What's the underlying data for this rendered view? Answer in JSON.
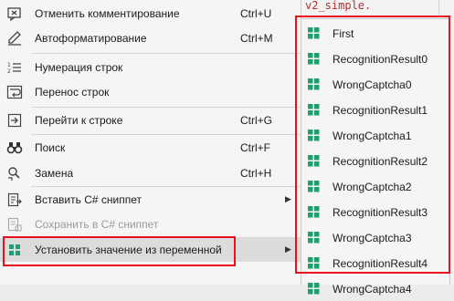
{
  "background": {
    "editor_code": "v2_simple."
  },
  "menu": {
    "items": [
      {
        "label": "Отменить комментирование",
        "shortcut": "Ctrl+U",
        "icon": "uncomment-icon"
      },
      {
        "label": "Автоформатирование",
        "shortcut": "Ctrl+M",
        "icon": "pencil-icon"
      },
      {
        "label": "Нумерация строк",
        "shortcut": "",
        "icon": "line-numbers-icon"
      },
      {
        "label": "Перенос строк",
        "shortcut": "",
        "icon": "word-wrap-icon"
      },
      {
        "label": "Перейти к строке",
        "shortcut": "Ctrl+G",
        "icon": "goto-line-icon"
      },
      {
        "label": "Поиск",
        "shortcut": "Ctrl+F",
        "icon": "binoculars-icon"
      },
      {
        "label": "Замена",
        "shortcut": "Ctrl+H",
        "icon": "replace-icon"
      },
      {
        "label": "Вставить C# сниппет",
        "shortcut": "",
        "icon": "insert-snippet-icon"
      },
      {
        "label": "Сохранить в C# сниппет",
        "shortcut": "",
        "icon": "save-snippet-icon"
      },
      {
        "label": "Установить значение из переменной",
        "shortcut": "",
        "icon": "variable-grid-icon"
      }
    ]
  },
  "submenu": {
    "items": [
      {
        "label": "First"
      },
      {
        "label": "RecognitionResult0"
      },
      {
        "label": "WrongCaptcha0"
      },
      {
        "label": "RecognitionResult1"
      },
      {
        "label": "WrongCaptcha1"
      },
      {
        "label": "RecognitionResult2"
      },
      {
        "label": "WrongCaptcha2"
      },
      {
        "label": "RecognitionResult3"
      },
      {
        "label": "WrongCaptcha3"
      },
      {
        "label": "RecognitionResult4"
      },
      {
        "label": "WrongCaptcha4"
      }
    ]
  },
  "colors": {
    "highlight_border": "#e8101c",
    "grid_icon": "#1f9e6e",
    "menu_bg": "#f5f5f5"
  }
}
